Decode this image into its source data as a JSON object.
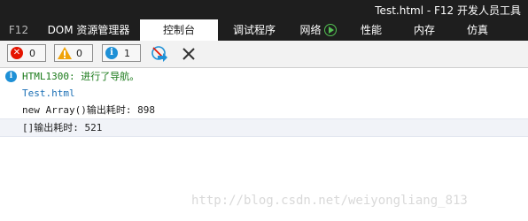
{
  "window": {
    "title": "Test.html - F12 开发人员工具"
  },
  "tabs": [
    {
      "label": "F12"
    },
    {
      "label": "DOM 资源管理器"
    },
    {
      "label": "控制台"
    },
    {
      "label": "调试程序"
    },
    {
      "label": "网络"
    },
    {
      "label": "性能"
    },
    {
      "label": "内存"
    },
    {
      "label": "仿真"
    }
  ],
  "toolbar": {
    "errors_count": "0",
    "warnings_count": "0",
    "messages_count": "1"
  },
  "console": {
    "nav_message": "HTML1300: 进行了导航。",
    "nav_source": "Test.html",
    "line1": "new Array()输出耗时: 898",
    "line2": "[]输出耗时: 521"
  },
  "colors": {
    "accent": "#1e90d6",
    "error": "#e51400",
    "warning": "#f0a30a"
  },
  "watermark": "http://blog.csdn.net/weiyongliang_813"
}
